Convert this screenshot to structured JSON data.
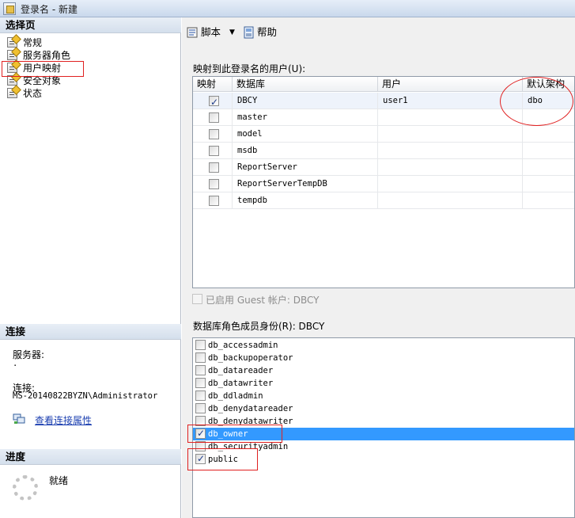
{
  "window": {
    "title": "登录名 - 新建"
  },
  "left": {
    "select_page_header": "选择页",
    "pages": [
      {
        "label": "常规"
      },
      {
        "label": "服务器角色"
      },
      {
        "label": "用户映射"
      },
      {
        "label": "安全对象"
      },
      {
        "label": "状态"
      }
    ],
    "connection_header": "连接",
    "server_label": "服务器:",
    "server_value": ".",
    "connection_label": "连接:",
    "connection_value": "MS-20140822BYZN\\Administrator",
    "view_conn_props_link": "查看连接属性",
    "progress_header": "进度",
    "progress_status": "就绪"
  },
  "toolbar": {
    "script_label": "脚本",
    "help_label": "帮助"
  },
  "mapping": {
    "label": "映射到此登录名的用户(U):",
    "columns": [
      "映射",
      "数据库",
      "用户",
      "默认架构"
    ],
    "rows": [
      {
        "mapped": true,
        "database": "DBCY",
        "user": "user1",
        "schema": "dbo"
      },
      {
        "mapped": false,
        "database": "master",
        "user": "",
        "schema": ""
      },
      {
        "mapped": false,
        "database": "model",
        "user": "",
        "schema": ""
      },
      {
        "mapped": false,
        "database": "msdb",
        "user": "",
        "schema": ""
      },
      {
        "mapped": false,
        "database": "ReportServer",
        "user": "",
        "schema": ""
      },
      {
        "mapped": false,
        "database": "ReportServerTempDB",
        "user": "",
        "schema": ""
      },
      {
        "mapped": false,
        "database": "tempdb",
        "user": "",
        "schema": ""
      }
    ]
  },
  "guest": {
    "label": "已启用 Guest 帐户: DBCY",
    "checked": false
  },
  "roles": {
    "label": "数据库角色成员身份(R): DBCY",
    "items": [
      {
        "name": "db_accessadmin",
        "checked": false
      },
      {
        "name": "db_backupoperator",
        "checked": false
      },
      {
        "name": "db_datareader",
        "checked": false
      },
      {
        "name": "db_datawriter",
        "checked": false
      },
      {
        "name": "db_ddladmin",
        "checked": false
      },
      {
        "name": "db_denydatareader",
        "checked": false
      },
      {
        "name": "db_denydatawriter",
        "checked": false
      },
      {
        "name": "db_owner",
        "checked": true
      },
      {
        "name": "db_securityadmin",
        "checked": false
      },
      {
        "name": "public",
        "checked": true
      }
    ]
  },
  "colors": {
    "selection": "#3399ff",
    "annotation": "#e02020",
    "link": "#1b3fb0"
  }
}
